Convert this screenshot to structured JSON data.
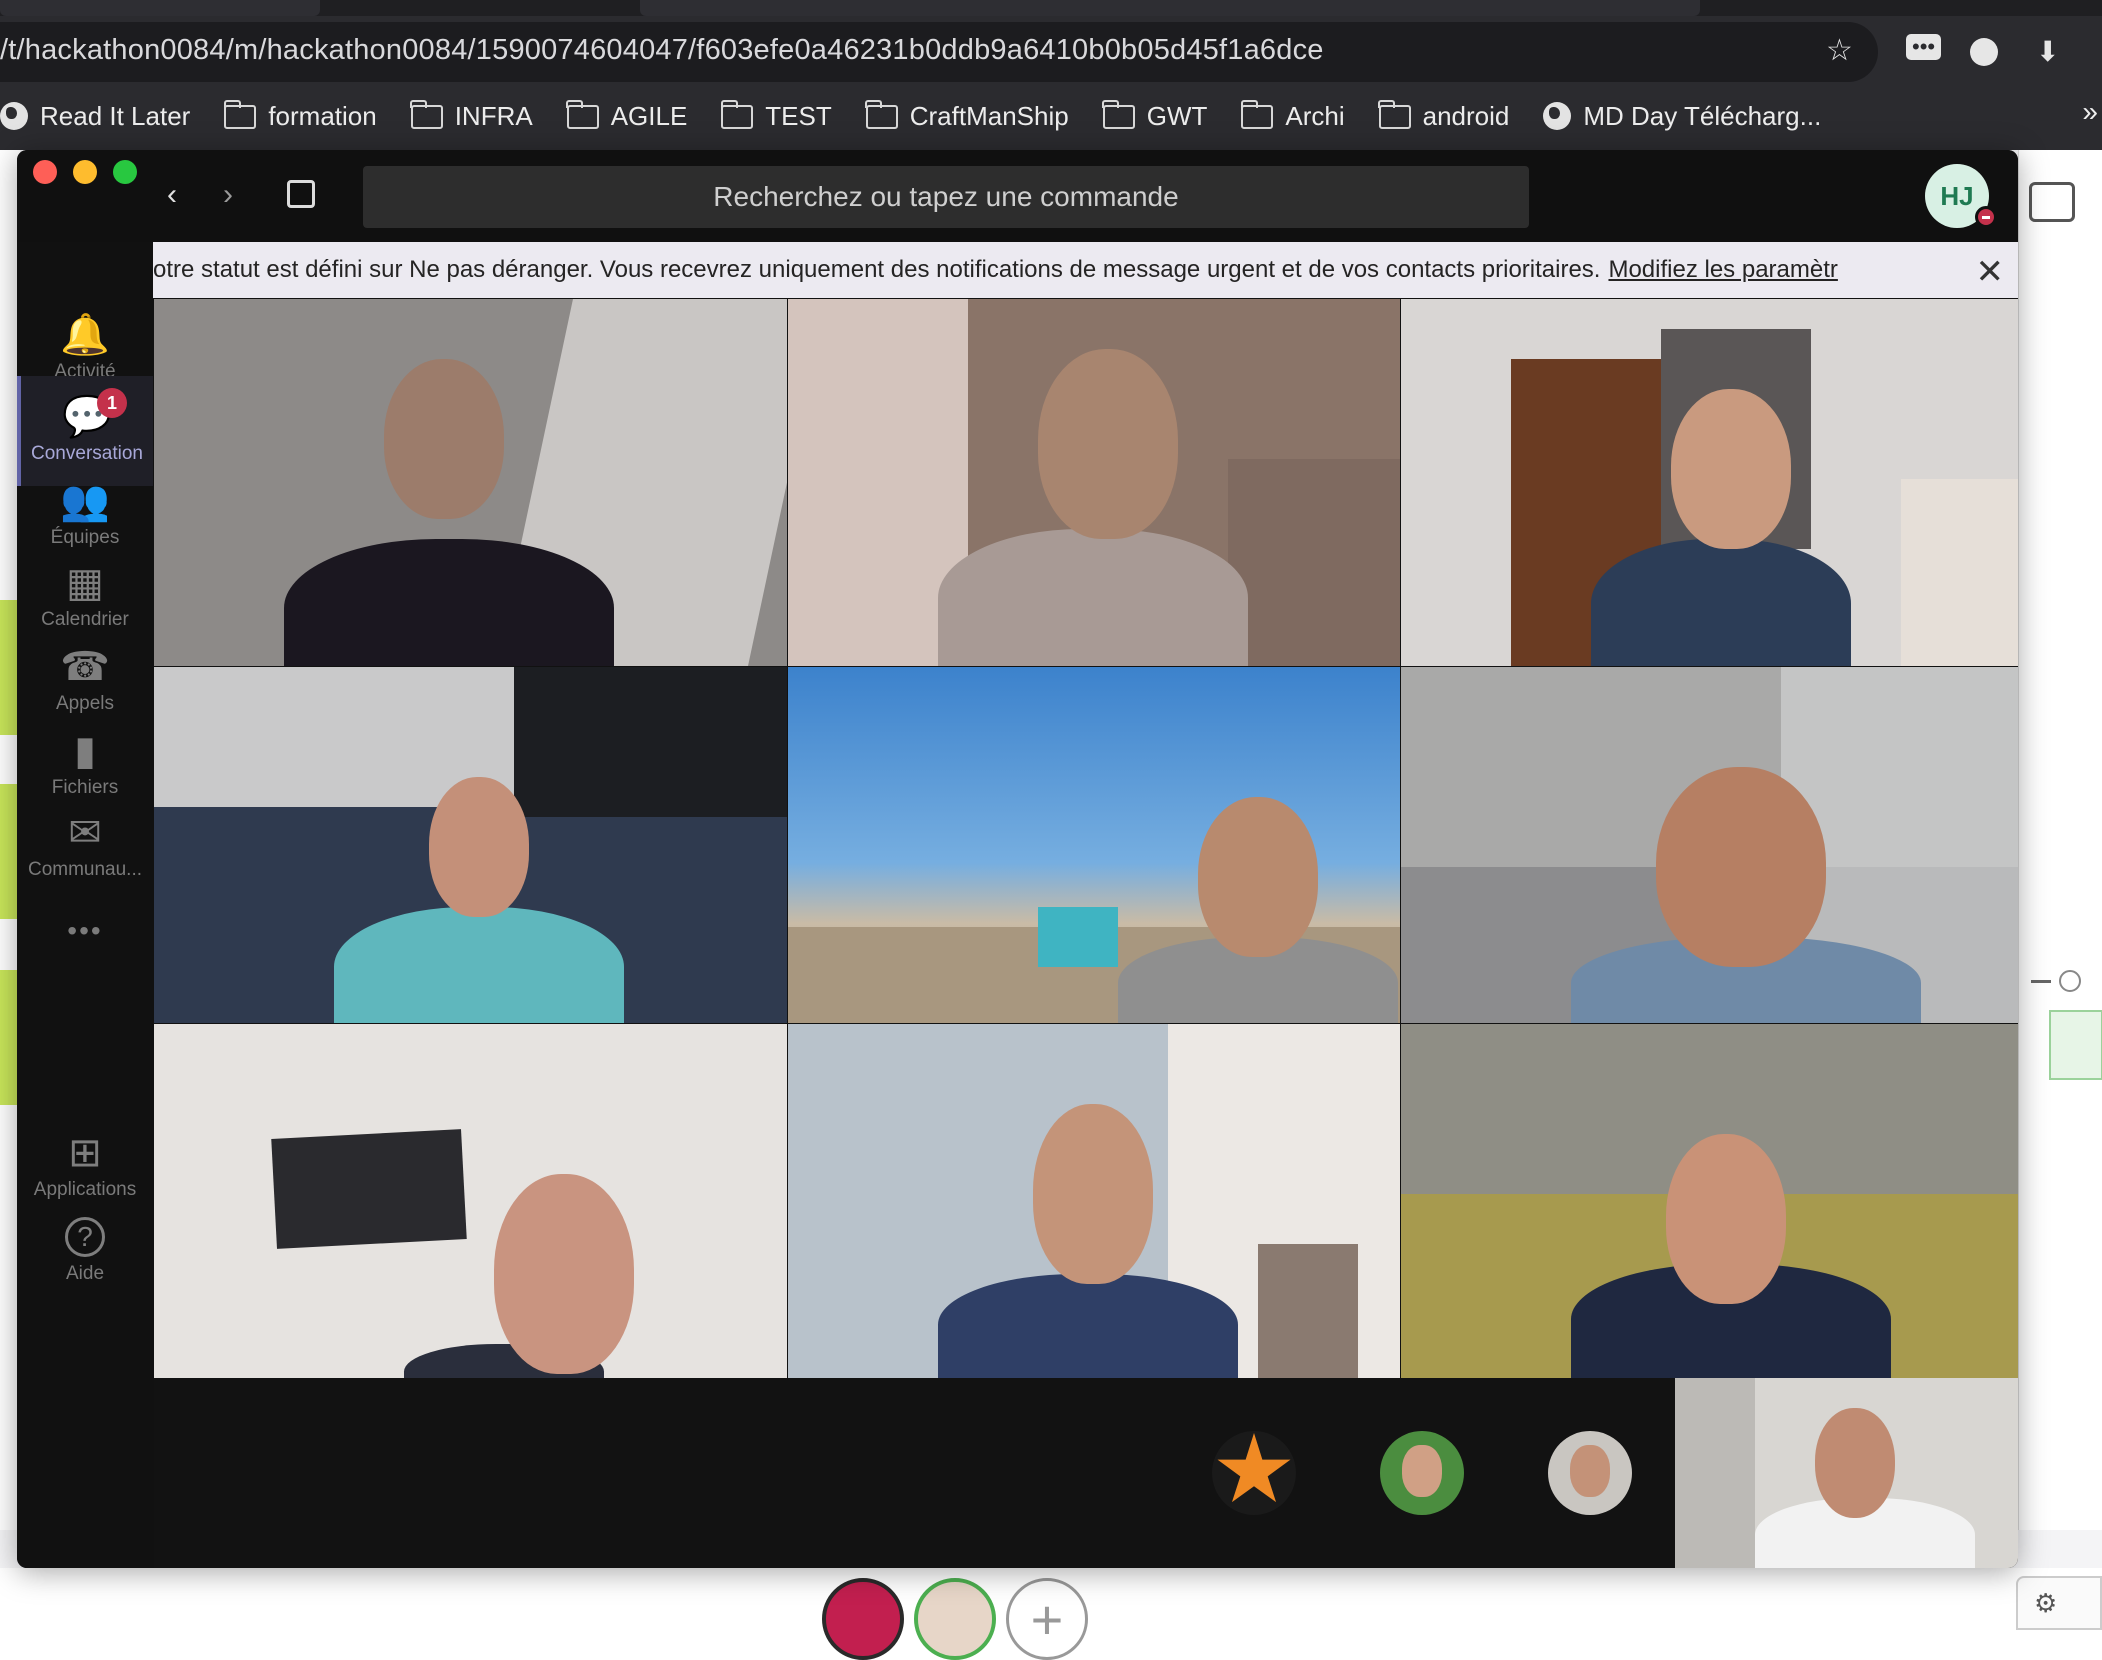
{
  "browser": {
    "url": "/t/hackathon0084/m/hackathon0084/1590074604047/f603efe0a46231b0ddb9a6410b0b05d45f1a6dce",
    "more_bookmarks": "»",
    "bookmarks": [
      {
        "label": "Read It Later",
        "icon": "globe-icon"
      },
      {
        "label": "formation",
        "icon": "folder-icon"
      },
      {
        "label": "INFRA",
        "icon": "folder-icon"
      },
      {
        "label": "AGILE",
        "icon": "folder-icon"
      },
      {
        "label": "TEST",
        "icon": "folder-icon"
      },
      {
        "label": "CraftManShip",
        "icon": "folder-icon"
      },
      {
        "label": "GWT",
        "icon": "folder-icon"
      },
      {
        "label": "Archi",
        "icon": "folder-icon"
      },
      {
        "label": "android",
        "icon": "folder-icon"
      },
      {
        "label": "MD Day Télécharg...",
        "icon": "globe-icon"
      }
    ]
  },
  "teams": {
    "search_placeholder": "Recherchez ou tapez une commande",
    "profile_initials": "HJ",
    "sidebar": [
      {
        "label": "Activité",
        "icon": "bell-icon"
      },
      {
        "label": "Conversation",
        "icon": "chat-icon",
        "badge": "1"
      },
      {
        "label": "Équipes",
        "icon": "teams-icon"
      },
      {
        "label": "Calendrier",
        "icon": "calendar-icon"
      },
      {
        "label": "Appels",
        "icon": "phone-icon"
      },
      {
        "label": "Fichiers",
        "icon": "file-icon"
      },
      {
        "label": "Communau...",
        "icon": "community-icon"
      },
      {
        "label": "•••",
        "icon": "more-icon"
      },
      {
        "label": "Applications",
        "icon": "apps-icon"
      },
      {
        "label": "Aide",
        "icon": "help-icon"
      }
    ],
    "banner": {
      "text": "otre statut est défini sur Ne pas déranger. Vous recevrez uniquement des notifications de message urgent et de vos contacts prioritaires.",
      "link": "Modifiez les paramètr",
      "close": "✕"
    }
  },
  "colors": {
    "accent": "#6264a7",
    "status_busy": "#c4314b",
    "browser_bg": "#2b2b2f",
    "teams_bg": "#111111"
  }
}
